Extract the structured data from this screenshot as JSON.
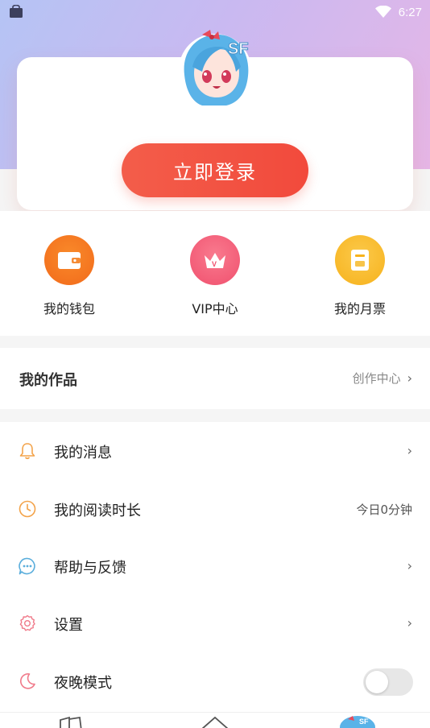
{
  "status_bar": {
    "time": "6:27"
  },
  "profile": {
    "login_label": "立即登录"
  },
  "quick_actions": [
    {
      "label": "我的钱包",
      "icon": "wallet-icon",
      "color": "#f26a1b"
    },
    {
      "label": "VIP中心",
      "icon": "crown-icon",
      "color": "#f0506e"
    },
    {
      "label": "我的月票",
      "icon": "ticket-icon",
      "color": "#f7b21c"
    }
  ],
  "works": {
    "title": "我的作品",
    "link_label": "创作中心"
  },
  "menu": [
    {
      "label": "我的消息",
      "icon": "bell-icon",
      "right": ""
    },
    {
      "label": "我的阅读时长",
      "icon": "clock-icon",
      "right": "今日0分钟"
    },
    {
      "label": "帮助与反馈",
      "icon": "chat-bubble-icon",
      "right": ""
    },
    {
      "label": "设置",
      "icon": "gear-icon",
      "right": ""
    },
    {
      "label": "夜晚模式",
      "icon": "moon-icon",
      "right": ""
    }
  ],
  "night_mode": {
    "enabled": false
  },
  "colors": {
    "accent": "#f24a3c",
    "hero_start": "#b5c4f4",
    "hero_end": "#e6b6e6"
  }
}
